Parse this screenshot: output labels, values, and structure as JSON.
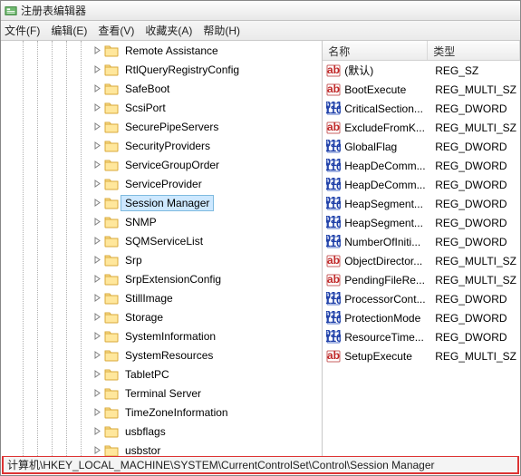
{
  "title": "注册表编辑器",
  "menubar": [
    "文件(F)",
    "编辑(E)",
    "查看(V)",
    "收藏夹(A)",
    "帮助(H)"
  ],
  "tree": [
    {
      "label": "Remote Assistance",
      "expandable": true
    },
    {
      "label": "RtlQueryRegistryConfig",
      "expandable": true
    },
    {
      "label": "SafeBoot",
      "expandable": true
    },
    {
      "label": "ScsiPort",
      "expandable": true
    },
    {
      "label": "SecurePipeServers",
      "expandable": true
    },
    {
      "label": "SecurityProviders",
      "expandable": true
    },
    {
      "label": "ServiceGroupOrder",
      "expandable": true
    },
    {
      "label": "ServiceProvider",
      "expandable": true
    },
    {
      "label": "Session Manager",
      "expandable": true,
      "selected": true
    },
    {
      "label": "SNMP",
      "expandable": true
    },
    {
      "label": "SQMServiceList",
      "expandable": true
    },
    {
      "label": "Srp",
      "expandable": true
    },
    {
      "label": "SrpExtensionConfig",
      "expandable": true
    },
    {
      "label": "StillImage",
      "expandable": true
    },
    {
      "label": "Storage",
      "expandable": true
    },
    {
      "label": "SystemInformation",
      "expandable": true
    },
    {
      "label": "SystemResources",
      "expandable": true
    },
    {
      "label": "TabletPC",
      "expandable": true
    },
    {
      "label": "Terminal Server",
      "expandable": true
    },
    {
      "label": "TimeZoneInformation",
      "expandable": true
    },
    {
      "label": "usbflags",
      "expandable": true
    },
    {
      "label": "usbstor",
      "expandable": true
    }
  ],
  "list": {
    "columns": {
      "name": "名称",
      "type": "类型"
    },
    "rows": [
      {
        "icon": "str",
        "name": "(默认)",
        "type": "REG_SZ"
      },
      {
        "icon": "str",
        "name": "BootExecute",
        "type": "REG_MULTI_SZ"
      },
      {
        "icon": "bin",
        "name": "CriticalSection...",
        "type": "REG_DWORD"
      },
      {
        "icon": "str",
        "name": "ExcludeFromK...",
        "type": "REG_MULTI_SZ"
      },
      {
        "icon": "bin",
        "name": "GlobalFlag",
        "type": "REG_DWORD"
      },
      {
        "icon": "bin",
        "name": "HeapDeComm...",
        "type": "REG_DWORD"
      },
      {
        "icon": "bin",
        "name": "HeapDeComm...",
        "type": "REG_DWORD"
      },
      {
        "icon": "bin",
        "name": "HeapSegment...",
        "type": "REG_DWORD"
      },
      {
        "icon": "bin",
        "name": "HeapSegment...",
        "type": "REG_DWORD"
      },
      {
        "icon": "bin",
        "name": "NumberOfIniti...",
        "type": "REG_DWORD"
      },
      {
        "icon": "str",
        "name": "ObjectDirector...",
        "type": "REG_MULTI_SZ"
      },
      {
        "icon": "str",
        "name": "PendingFileRe...",
        "type": "REG_MULTI_SZ"
      },
      {
        "icon": "bin",
        "name": "ProcessorCont...",
        "type": "REG_DWORD"
      },
      {
        "icon": "bin",
        "name": "ProtectionMode",
        "type": "REG_DWORD"
      },
      {
        "icon": "bin",
        "name": "ResourceTime...",
        "type": "REG_DWORD"
      },
      {
        "icon": "str",
        "name": "SetupExecute",
        "type": "REG_MULTI_SZ"
      }
    ]
  },
  "statusbar": "计算机\\HKEY_LOCAL_MACHINE\\SYSTEM\\CurrentControlSet\\Control\\Session Manager"
}
